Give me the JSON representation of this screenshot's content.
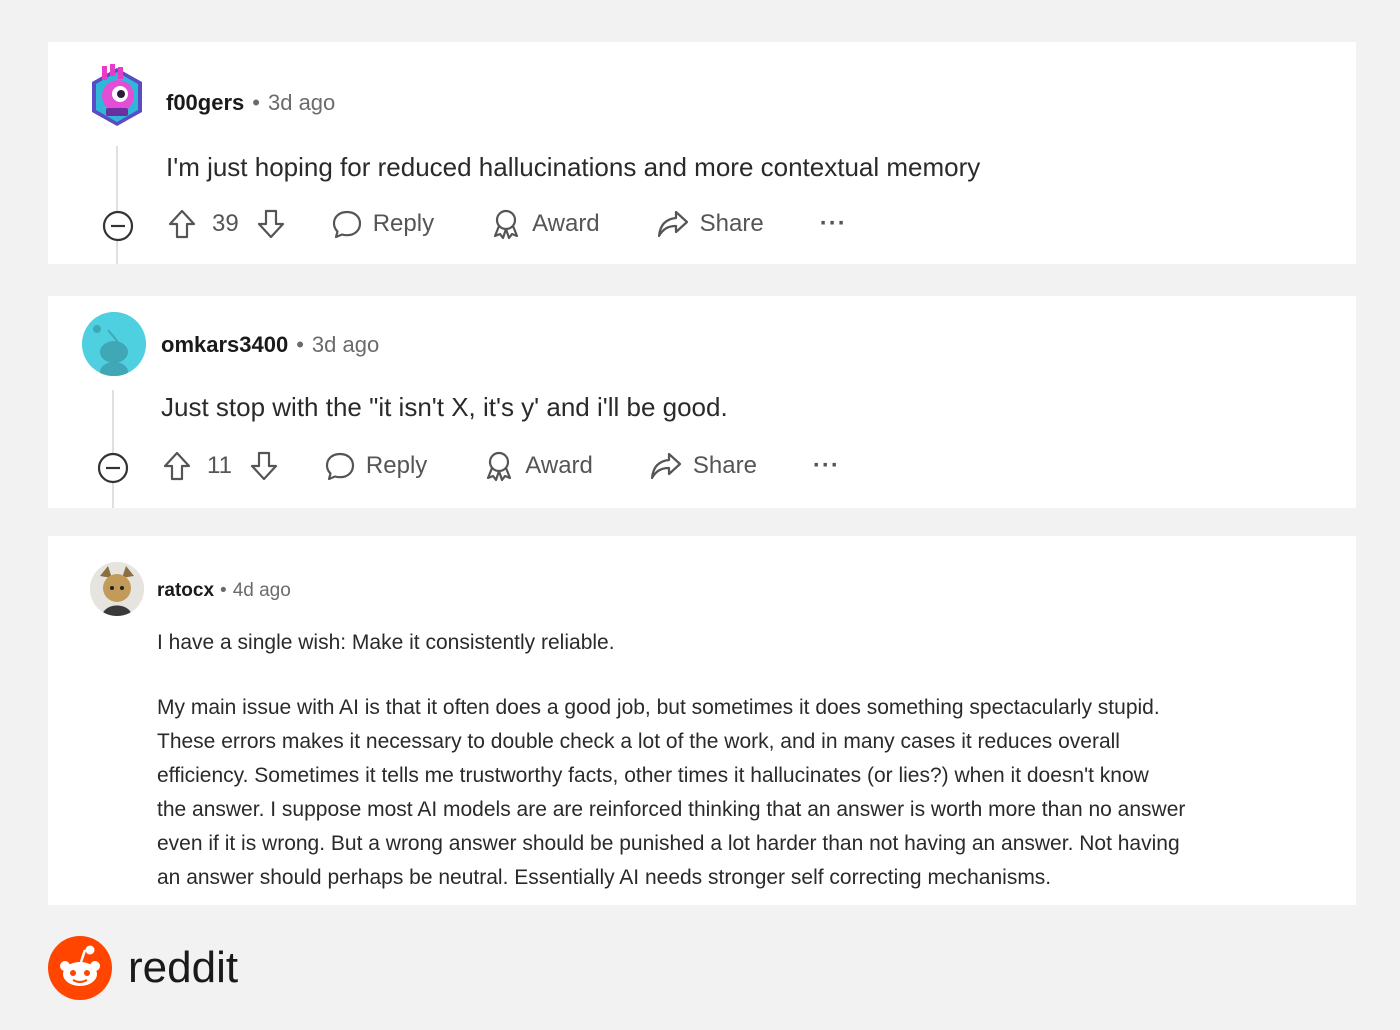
{
  "comments": [
    {
      "username": "f00gers",
      "separator": "•",
      "time": "3d ago",
      "body": "I'm just hoping for reduced hallucinations and more contextual memory",
      "score": "39",
      "reply_label": "Reply",
      "award_label": "Award",
      "share_label": "Share",
      "more_label": "···"
    },
    {
      "username": "omkars3400",
      "separator": "•",
      "time": "3d ago",
      "body": "Just stop with the \"it isn't X, it's y' and i'll be good.",
      "score": "11",
      "reply_label": "Reply",
      "award_label": "Award",
      "share_label": "Share",
      "more_label": "···"
    },
    {
      "username": "ratocx",
      "separator": "•",
      "time": "4d ago",
      "body_paragraph_1": "I have a single wish: Make it consistently reliable.",
      "body_paragraph_2_lines": [
        "My main issue with AI is that it often does a good job, but sometimes it does something spectacularly stupid.",
        "These errors makes it necessary to double check a lot of the work, and in many cases it reduces overall",
        "efficiency. Sometimes it tells me trustworthy facts, other times it hallucinates (or lies?) when it doesn't know",
        "the answer. I suppose most AI models are are reinforced thinking that an answer is worth more than no answer",
        "even if it is wrong. But a wrong answer should be punished a lot harder than not having an answer. Not having",
        "an answer should perhaps be neutral. Essentially AI needs stronger self correcting mechanisms."
      ]
    }
  ],
  "footer": {
    "brand": "reddit"
  },
  "colors": {
    "brand_orange": "#ff4500",
    "page_bg": "#f2f2f2",
    "card_bg": "#ffffff",
    "avatar_teal": "#4fd0e0"
  }
}
